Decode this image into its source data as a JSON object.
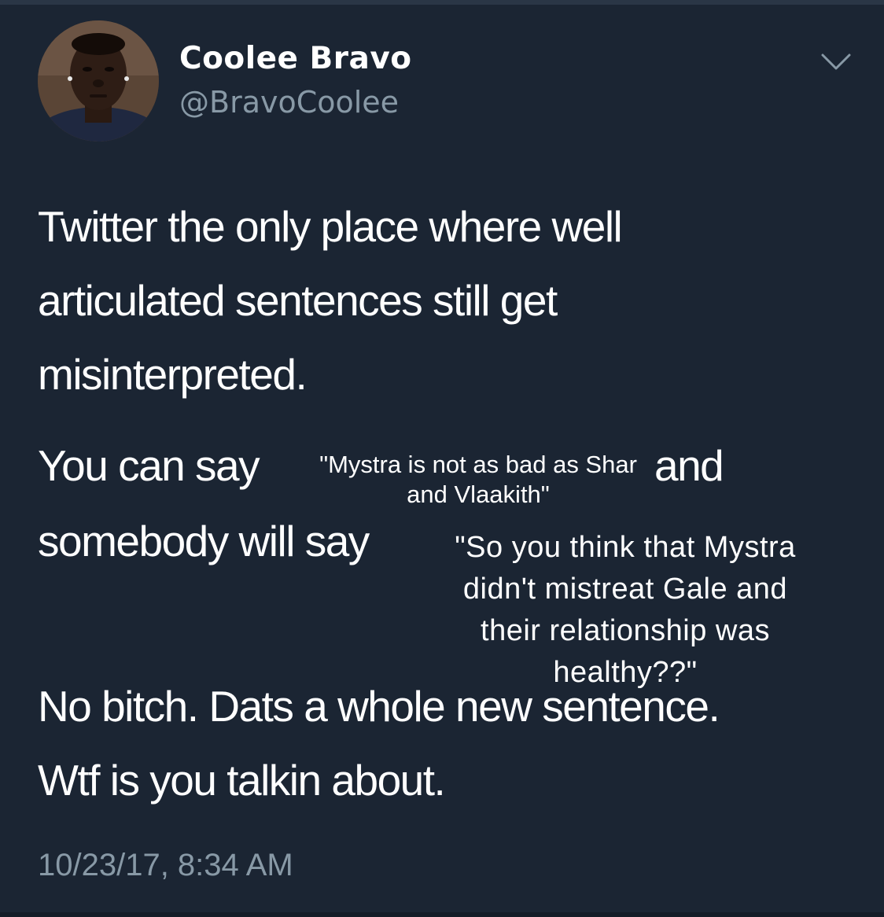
{
  "tweet": {
    "display_name": "Coolee Bravo",
    "handle": "@BravoCoolee",
    "lines": [
      "Twitter the only place where well",
      "articulated sentences still get",
      "misinterpreted.",
      "You can say",
      "and",
      "somebody will say",
      "No bitch. Dats a whole new sentence.",
      "Wtf is you talkin about."
    ],
    "quote_1": "\"Mystra is not as bad as Shar\nand Vlaakith\"",
    "quote_2": "\"So you think that Mystra\ndidn't mistreat Gale and\ntheir relationship was\nhealthy??\"",
    "timestamp": "10/23/17, 8:34 AM"
  },
  "icons": {
    "menu": "chevron-down-icon",
    "avatar": "profile-photo"
  },
  "colors": {
    "background": "#1b2533",
    "text": "#ffffff",
    "secondary_text": "#8899a6"
  }
}
